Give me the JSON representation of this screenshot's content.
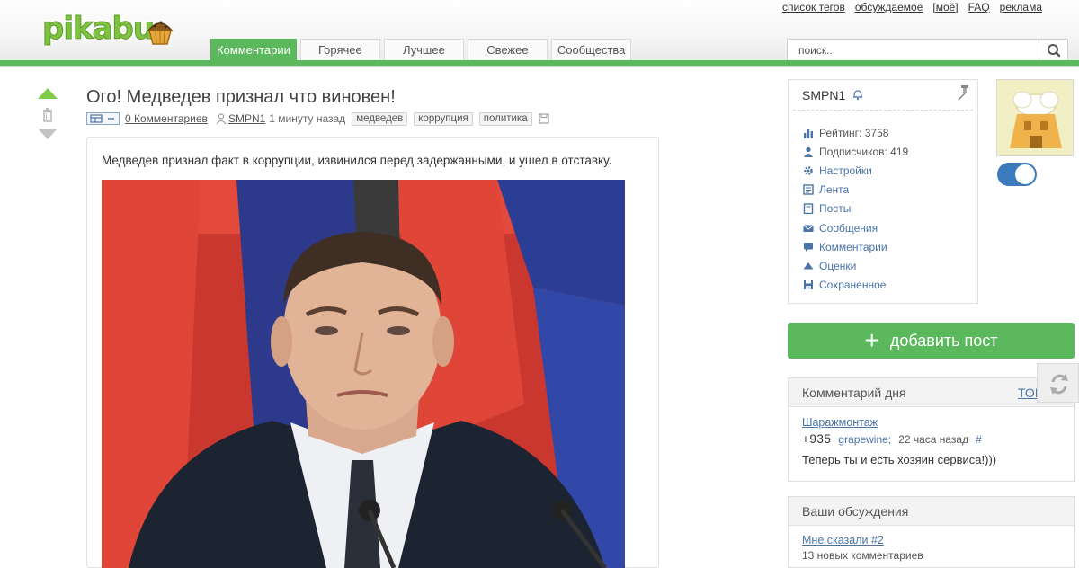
{
  "logo": {
    "text": "pikabu"
  },
  "top_links": [
    "список тегов",
    "обсуждаемое",
    "[моё]",
    "FAQ",
    "реклама"
  ],
  "nav_tabs": [
    {
      "label": "Комментарии",
      "active": true
    },
    {
      "label": "Горячее",
      "active": false
    },
    {
      "label": "Лучшее",
      "active": false
    },
    {
      "label": "Свежее",
      "active": false
    },
    {
      "label": "Сообщества",
      "active": false
    }
  ],
  "search": {
    "placeholder": "поиск..."
  },
  "post": {
    "title": "Ого! Медведев признал что виновен!",
    "comments_link": "0 Комментариев",
    "author": "SMPN1",
    "time": "1 минуту назад",
    "tags": [
      "медведев",
      "коррупция",
      "политика"
    ],
    "text": "Медведев признал факт в коррупции, извинился перед задержанными, и ушел в отставку."
  },
  "profile": {
    "username": "SMPN1",
    "menu": [
      {
        "icon": "bar-chart-icon",
        "label": "Рейтинг: 3758",
        "link": false
      },
      {
        "icon": "person-icon",
        "label": "Подписчиков: 419",
        "link": false
      },
      {
        "icon": "gear-icon",
        "label": "Настройки",
        "link": true
      },
      {
        "icon": "feed-icon",
        "label": "Лента",
        "link": true
      },
      {
        "icon": "posts-icon",
        "label": "Посты",
        "link": true
      },
      {
        "icon": "envelope-icon",
        "label": "Сообщения",
        "link": true
      },
      {
        "icon": "comment-icon",
        "label": "Комментарии",
        "link": true
      },
      {
        "icon": "triangle-up-icon",
        "label": "Оценки",
        "link": true
      },
      {
        "icon": "floppy-icon",
        "label": "Сохраненное",
        "link": true
      }
    ],
    "toggle_on": true
  },
  "add_post": {
    "label": "добавить пост"
  },
  "comment_of_day": {
    "title": "Комментарий дня",
    "top_link": "ТОП",
    "post_link": "Шаражмонтаж",
    "score": "+935",
    "author": "grapewine;",
    "time": "22 часа назад",
    "hash": "#",
    "text": "Теперь ты и есть хозяин сервиса!)))"
  },
  "discussions": {
    "title": "Ваши обсуждения",
    "link": "Мне сказали #2",
    "sub": "13 новых комментариев"
  },
  "colors": {
    "accent_green": "#5cb85c",
    "link_blue": "#4a73a8",
    "toggle_blue": "#3a7abd"
  }
}
